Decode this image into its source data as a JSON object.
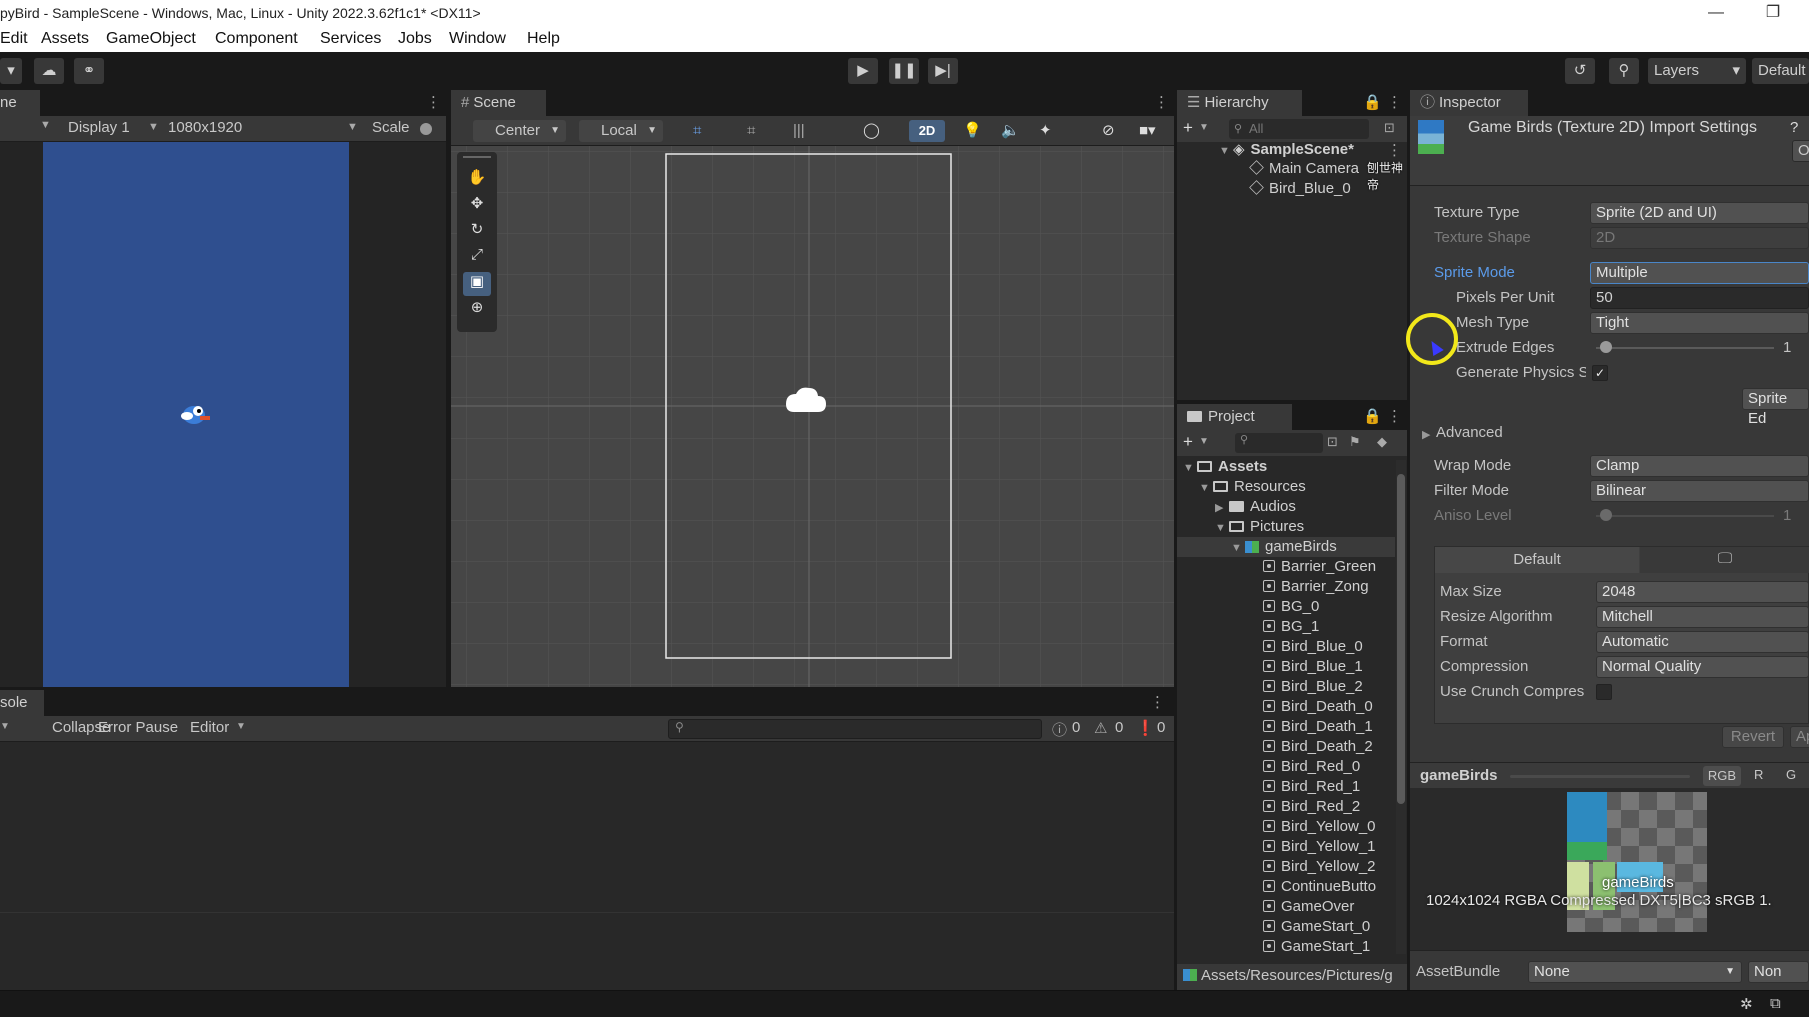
{
  "window": {
    "title": "pyBird - SampleScene - Windows, Mac, Linux - Unity 2022.3.62f1c1* <DX11>",
    "minimize": "—",
    "maximize": "❐"
  },
  "menu": [
    "Edit",
    "Assets",
    "GameObject",
    "Component",
    "Services",
    "Jobs",
    "Window",
    "Help"
  ],
  "toolbar": {
    "layers_label": "Layers",
    "layout_label": "Default"
  },
  "game_view": {
    "tab_label": "ne",
    "display": "Display 1",
    "resolution": "1080x1920",
    "scale_label": "Scale",
    "bg_color": "#2f4f8f"
  },
  "scene_view": {
    "tab_label": "Scene",
    "pivot": "Center",
    "space": "Local",
    "mode_2d": "2D"
  },
  "console": {
    "tab_label": "sole",
    "collapse": "Collapse",
    "error_pause": "Error Pause",
    "editor": "Editor",
    "info_count": "0",
    "warn_count": "0",
    "error_count": "0"
  },
  "hierarchy": {
    "tab_label": "Hierarchy",
    "search_placeholder": "All",
    "scene": "SampleScene*",
    "objects": [
      "Main Camera",
      "Bird_Blue_0"
    ],
    "overlay_text": "刨世神帝"
  },
  "project": {
    "tab_label": "Project",
    "assets_label": "Assets",
    "resources": "Resources",
    "audios": "Audios",
    "pictures": "Pictures",
    "gamebirds": "gameBirds",
    "sprites": [
      "Barrier_Green",
      "Barrier_Zong",
      "BG_0",
      "BG_1",
      "Bird_Blue_0",
      "Bird_Blue_1",
      "Bird_Blue_2",
      "Bird_Death_0",
      "Bird_Death_1",
      "Bird_Death_2",
      "Bird_Red_0",
      "Bird_Red_1",
      "Bird_Red_2",
      "Bird_Yellow_0",
      "Bird_Yellow_1",
      "Bird_Yellow_2",
      "ContinueButto",
      "GameOver",
      "GameStart_0",
      "GameStart_1"
    ],
    "path": "Assets/Resources/Pictures/g"
  },
  "inspector": {
    "tab_label": "Inspector",
    "title": "Game Birds (Texture 2D) Import Settings",
    "open_button": "O",
    "texture_type_label": "Texture Type",
    "texture_type": "Sprite (2D and UI)",
    "texture_shape_label": "Texture Shape",
    "texture_shape": "2D",
    "sprite_mode_label": "Sprite Mode",
    "sprite_mode": "Multiple",
    "ppu_label": "Pixels Per Unit",
    "ppu": "50",
    "mesh_type_label": "Mesh Type",
    "mesh_type": "Tight",
    "extrude_label": "Extrude Edges",
    "extrude": "1",
    "physics_label": "Generate Physics S",
    "sprite_editor_button": "Sprite Ed",
    "advanced_label": "Advanced",
    "wrap_label": "Wrap Mode",
    "wrap": "Clamp",
    "filter_label": "Filter Mode",
    "filter": "Bilinear",
    "aniso_label": "Aniso Level",
    "aniso": "1",
    "platform_default": "Default",
    "max_size_label": "Max Size",
    "max_size": "2048",
    "resize_label": "Resize Algorithm",
    "resize": "Mitchell",
    "format_label": "Format",
    "format": "Automatic",
    "compression_label": "Compression",
    "compression": "Normal Quality",
    "crunch_label": "Use Crunch Compres",
    "revert": "Revert",
    "apply": "Ap",
    "preview_title": "gameBirds",
    "channel_rgb": "RGB",
    "channel_r": "R",
    "channel_g": "G",
    "preview_name": "gameBirds",
    "preview_info": "1024x1024  RGBA Compressed DXT5|BC3 sRGB  1.",
    "assetbundle_label": "AssetBundle",
    "assetbundle": "None",
    "assetbundle_variant": "Non"
  },
  "colors": {
    "accent_blue": "#3a72b0",
    "highlight_ring": "#f2e81a"
  }
}
